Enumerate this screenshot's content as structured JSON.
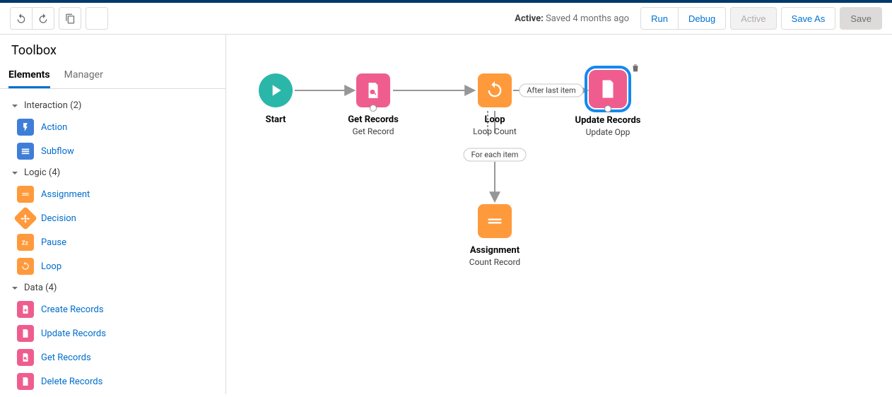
{
  "topbar": {
    "status_label": "Active:",
    "status_text": "Saved 4 months ago",
    "buttons": {
      "run": "Run",
      "debug": "Debug",
      "activate": "Active",
      "saveas": "Save As",
      "save": "Save"
    }
  },
  "sidebar": {
    "title": "Toolbox",
    "tabs": {
      "elements": "Elements",
      "manager": "Manager"
    },
    "groups": {
      "interaction": {
        "label": "Interaction (2)",
        "items": {
          "action": "Action",
          "subflow": "Subflow"
        }
      },
      "logic": {
        "label": "Logic (4)",
        "items": {
          "assignment": "Assignment",
          "decision": "Decision",
          "pause": "Pause",
          "loop": "Loop"
        }
      },
      "data": {
        "label": "Data (4)",
        "items": {
          "create": "Create Records",
          "update": "Update Records",
          "get": "Get Records",
          "delete": "Delete Records"
        }
      }
    }
  },
  "canvas": {
    "nodes": {
      "start": {
        "title": "Start"
      },
      "get": {
        "title": "Get Records",
        "sub": "Get Record"
      },
      "loop": {
        "title": "Loop",
        "sub": "Loop Count"
      },
      "update": {
        "title": "Update Records",
        "sub": "Update Opp"
      },
      "assign": {
        "title": "Assignment",
        "sub": "Count Record"
      }
    },
    "edge_labels": {
      "after_last": "After last item",
      "for_each": "For each item"
    }
  }
}
